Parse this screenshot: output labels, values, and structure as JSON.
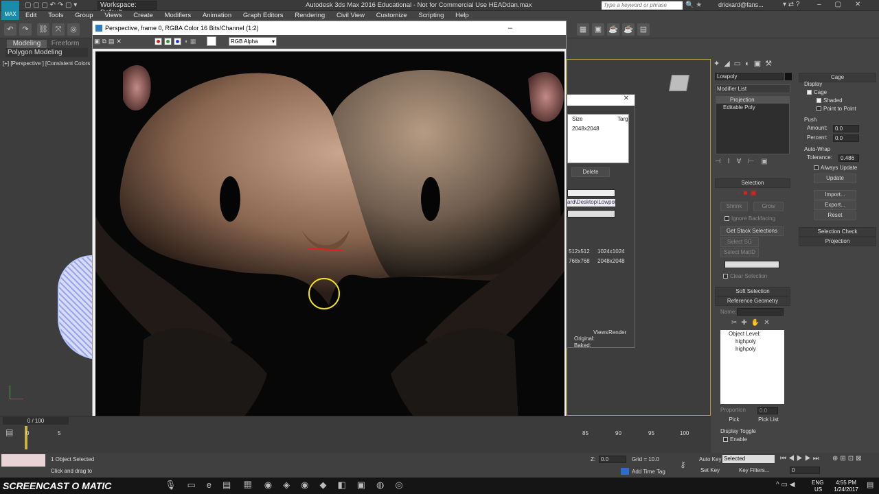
{
  "app": {
    "title": "Autodesk 3ds Max 2016 Educational - Not for Commercial Use    HEADdan.max",
    "workspace": "Workspace: Default",
    "search_placeholder": "Type a keyword or phrase",
    "user": "drickard@fans..."
  },
  "menu": [
    "Edit",
    "Tools",
    "Group",
    "Views",
    "Create",
    "Modifiers",
    "Animation",
    "Graph Editors",
    "Rendering",
    "Civil View",
    "Customize",
    "Scripting",
    "Help"
  ],
  "ribbon": {
    "tabs": [
      "Modeling",
      "Freeform"
    ],
    "label": "Polygon Modeling"
  },
  "viewport_left": {
    "label": "[+] [Perspective ] [Consistent Colors +"
  },
  "frame_buffer": {
    "title": "Perspective, frame 0, RGBA Color 16 Bits/Channel (1:2)",
    "channel": "RGB Alpha",
    "colors": {
      "red": "#e02020",
      "green": "#20a020",
      "blue": "#2040e0"
    }
  },
  "bake_dialog": {
    "col_size": "Size",
    "col_target": "Targ",
    "row_value": "2048x2048",
    "delete_label": "Delete",
    "path": "ard\\Desktop\\Lowpoly",
    "sizes": [
      "512x512",
      "1024x1024",
      "768x768",
      "2048x2048"
    ],
    "views_label": "Views",
    "render_label": "Render",
    "original_label": "Original:",
    "baked_label": "Baked:"
  },
  "command_panel": {
    "object_name": "Lowpoly",
    "modifier_list": "Modifier List",
    "stack": [
      "Projection",
      "Editable Poly"
    ],
    "selection": {
      "title": "Selection",
      "shrink": "Shrink",
      "grow": "Grow",
      "ignore_backfacing": "Ignore Backfacing",
      "get_stack": "Get Stack Selections",
      "select_sg": "Select SG",
      "select_matid": "Select MatID",
      "clear_selection": "Clear Selection"
    },
    "soft_selection": "Soft Selection",
    "reference_geometry": {
      "title": "Reference Geometry",
      "name_label": "Name:",
      "object_level": "Object Level:",
      "items": [
        "highpoly",
        "highpoly"
      ],
      "proportion": "Proportion",
      "proportion_value": "0.0",
      "pick": "Pick",
      "pick_list": "Pick List",
      "display_toggle": "Display Toggle",
      "enable": "Enable"
    },
    "cage": {
      "title": "Cage",
      "display": "Display",
      "cage_label": "Cage",
      "shaded": "Shaded",
      "point_to_point": "Point to Point",
      "push": "Push",
      "amount_label": "Amount:",
      "amount": "0.0",
      "percent_label": "Percent:",
      "percent": "0.0",
      "auto_wrap": "Auto-Wrap",
      "tolerance_label": "Tolerance:",
      "tolerance": "0.486",
      "always_update": "Always Update",
      "update": "Update",
      "import": "Import...",
      "export": "Export...",
      "reset": "Reset"
    },
    "selection_check": "Selection Check",
    "projection": "Projection"
  },
  "timeline": {
    "frame": "0 / 100",
    "ticks_left": [
      "0",
      "5"
    ],
    "ticks_right": [
      "85",
      "90",
      "95",
      "100"
    ]
  },
  "status": {
    "selected": "1 Object Selected",
    "hint": "Click and drag to s",
    "z_label": "Z:",
    "z_value": "0.0",
    "grid": "Grid = 10.0",
    "add_time_tag": "Add Time Tag",
    "auto_key": "Auto Key",
    "selected_dropdown": "Selected",
    "set_key": "Set Key",
    "key_filters": "Key Filters...",
    "frame_field": "0"
  },
  "taskbar": {
    "watermark": "SCREENCAST O MATIC",
    "lang": "ENG",
    "locale": "US",
    "time": "4:55 PM",
    "date": "1/24/2017"
  }
}
